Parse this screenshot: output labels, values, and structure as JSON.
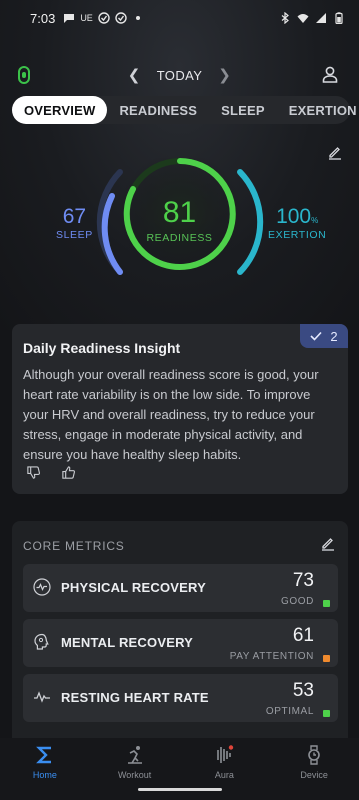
{
  "status_bar": {
    "time": "7:03",
    "left_icons": [
      "chat-icon",
      "ue-badge",
      "check-circle-icon",
      "check-circle-icon",
      "dot"
    ],
    "ue_text": "UE"
  },
  "header": {
    "day_label": "TODAY"
  },
  "tabs": [
    {
      "label": "OVERVIEW",
      "active": true
    },
    {
      "label": "READINESS",
      "active": false
    },
    {
      "label": "SLEEP",
      "active": false
    },
    {
      "label": "EXERTION",
      "active": false
    }
  ],
  "scores": {
    "sleep": {
      "value": "67",
      "label": "SLEEP",
      "color": "#6f8cf3"
    },
    "readiness": {
      "value": "81",
      "label": "READINESS",
      "color": "#4ed14a"
    },
    "exertion": {
      "value": "100",
      "unit": "%",
      "label": "EXERTION",
      "color": "#2ab6cc"
    }
  },
  "insight": {
    "title": "Daily Readiness Insight",
    "body": "Although your overall readiness score is good, your heart rate variability is on the low side. To improve your HRV and overall readiness, try to reduce your stress, engage in moderate physical activity, and ensure you have healthy sleep habits.",
    "badge_count": "2"
  },
  "core_metrics": {
    "heading": "CORE METRICS",
    "items": [
      {
        "name": "PHYSICAL RECOVERY",
        "value": "73",
        "status": "GOOD",
        "status_color": "#4ed14a",
        "icon": "activity-icon"
      },
      {
        "name": "MENTAL RECOVERY",
        "value": "61",
        "status": "PAY ATTENTION",
        "status_color": "#f08a2e",
        "icon": "brain-icon"
      },
      {
        "name": "RESTING HEART RATE",
        "value": "53",
        "status": "OPTIMAL",
        "status_color": "#4ed14a",
        "icon": "heartbeat-icon"
      }
    ]
  },
  "bottom_nav": [
    {
      "label": "Home",
      "active": true,
      "icon": "sigma-icon"
    },
    {
      "label": "Workout",
      "active": false,
      "icon": "runner-icon"
    },
    {
      "label": "Aura",
      "active": false,
      "icon": "aura-icon"
    },
    {
      "label": "Device",
      "active": false,
      "icon": "watch-icon"
    }
  ],
  "colors": {
    "accent_blue": "#3a8ef0",
    "background": "#141518",
    "card": "#26282c"
  }
}
